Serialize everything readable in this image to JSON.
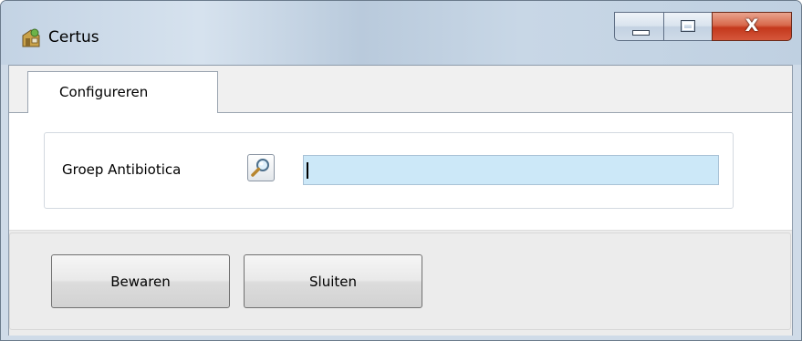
{
  "window": {
    "title": "Certus",
    "icon": "certus-app-icon",
    "controls": {
      "minimize": "minimize-icon",
      "maximize": "maximize-icon",
      "close": "close-icon"
    },
    "close_glyph": "X"
  },
  "tabs": [
    {
      "label": "Configureren",
      "active": true
    }
  ],
  "form": {
    "field_label": "Groep Antibiotica",
    "search_icon": "magnifier-icon",
    "input_value": "",
    "input_placeholder": ""
  },
  "buttons": {
    "save_label": "Bewaren",
    "close_label": "Sluiten"
  },
  "colors": {
    "input_background": "#cce8f8",
    "close_button": "#c4381c"
  }
}
